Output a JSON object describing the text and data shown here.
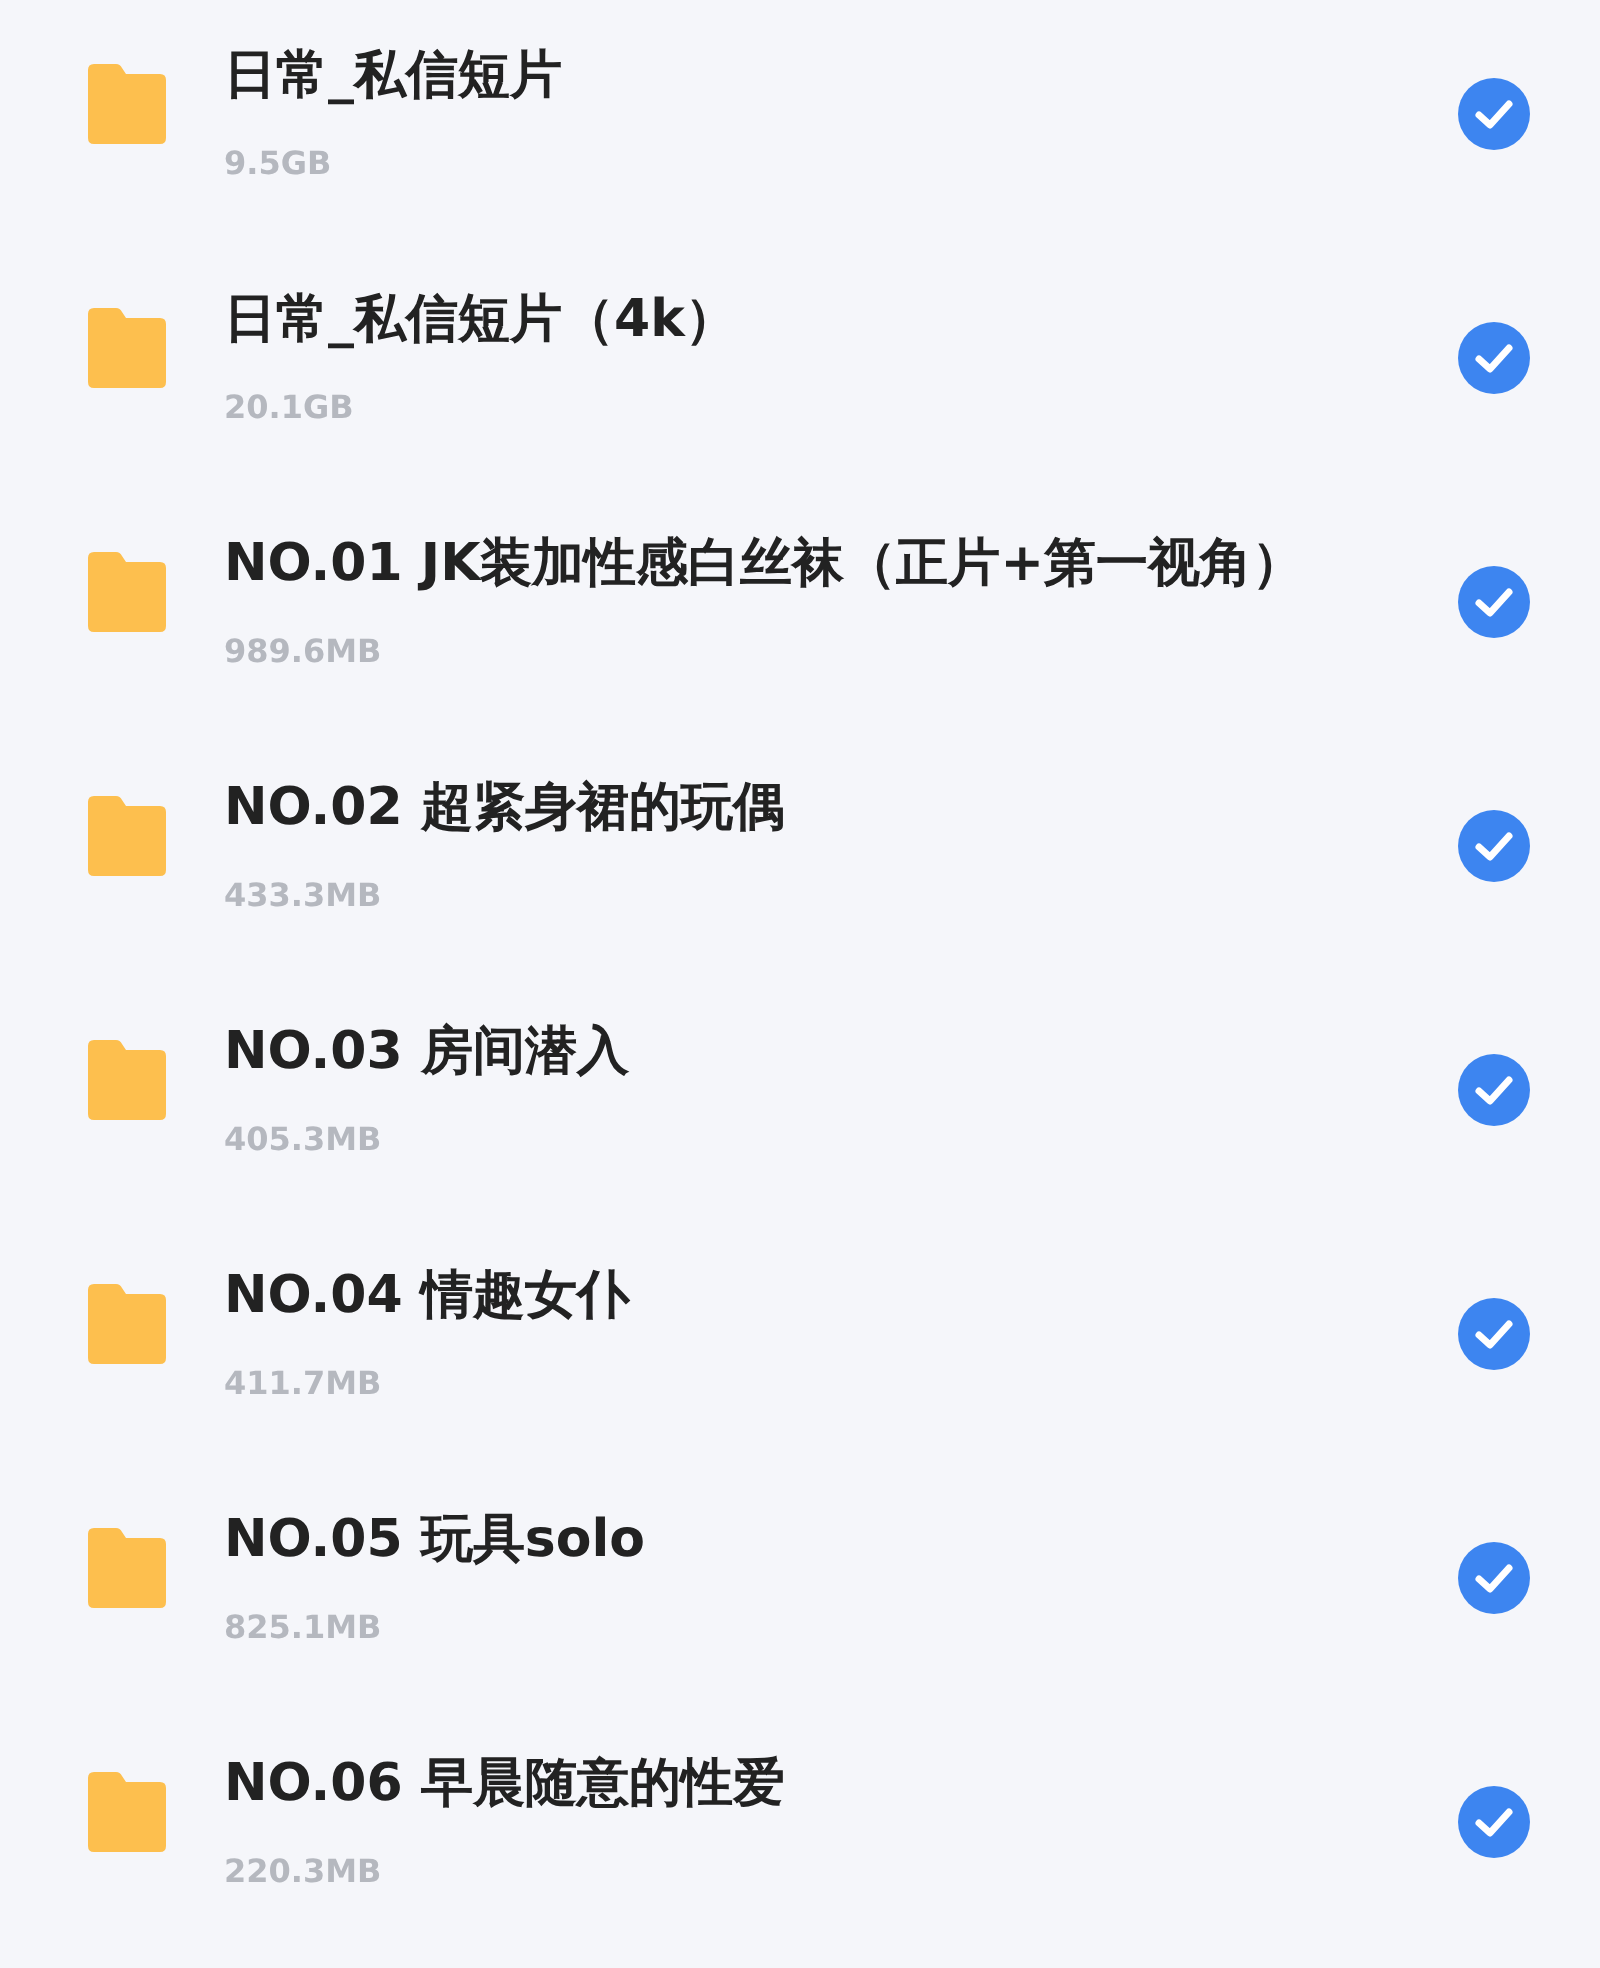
{
  "files": [
    {
      "name": "日常_私信短片",
      "size": "9.5GB",
      "checked": true
    },
    {
      "name": "日常_私信短片（4k）",
      "size": "20.1GB",
      "checked": true
    },
    {
      "name": "NO.01 JK装加性感白丝袜（正片+第一视角）",
      "size": "989.6MB",
      "checked": true
    },
    {
      "name": "NO.02 超紧身裙的玩偶",
      "size": "433.3MB",
      "checked": true
    },
    {
      "name": "NO.03 房间潜入",
      "size": "405.3MB",
      "checked": true
    },
    {
      "name": "NO.04 情趣女仆",
      "size": "411.7MB",
      "checked": true
    },
    {
      "name": "NO.05 玩具solo",
      "size": "825.1MB",
      "checked": true
    },
    {
      "name": "NO.06 早晨随意的性爱",
      "size": "220.3MB",
      "checked": true
    }
  ]
}
